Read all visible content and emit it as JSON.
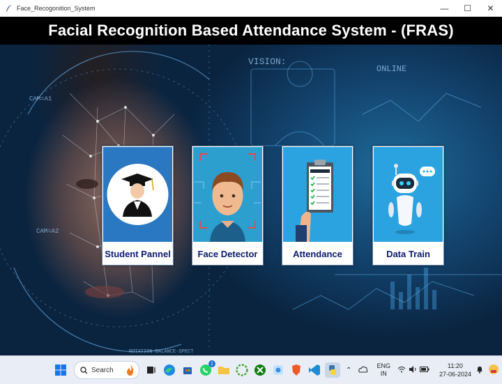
{
  "window": {
    "title": "Face_Recogonition_System"
  },
  "banner": {
    "title": "Facial Recognition Based Attendance System - (FRAS)"
  },
  "background": {
    "vision_text": "VISION:",
    "online_text": "ONLINE",
    "cam_a1": "CAM=A1",
    "cam_a2": "CAM=A2",
    "rotation_text": "ROTATION-BALANCE-SPECT"
  },
  "cards": [
    {
      "label": "Student Pannel",
      "icon": "graduate-icon"
    },
    {
      "label": "Face Detector",
      "icon": "face-scan-icon"
    },
    {
      "label": "Attendance",
      "icon": "attendance-clipboard-icon"
    },
    {
      "label": "Data Train",
      "icon": "robot-icon"
    }
  ],
  "taskbar": {
    "search_label": "Search",
    "whatsapp_badge": "1",
    "lang_top": "ENG",
    "lang_bottom": "IN",
    "time": "11:20",
    "date": "27-06-2024"
  }
}
